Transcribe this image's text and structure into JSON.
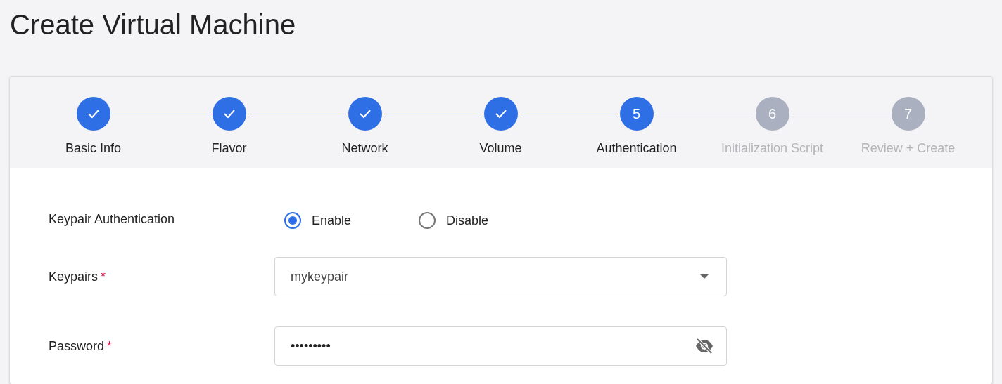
{
  "page_title": "Create Virtual Machine",
  "steps": [
    {
      "label": "Basic Info",
      "kind": "complete"
    },
    {
      "label": "Flavor",
      "kind": "complete"
    },
    {
      "label": "Network",
      "kind": "complete"
    },
    {
      "label": "Volume",
      "kind": "complete"
    },
    {
      "label": "Authentication",
      "kind": "active",
      "number": "5"
    },
    {
      "label": "Initialization Script",
      "kind": "pending",
      "number": "6"
    },
    {
      "label": "Review + Create",
      "kind": "pending",
      "number": "7"
    }
  ],
  "form": [
    {
      "kind": "radio",
      "label": "Keypair Authentication",
      "options": [
        {
          "label": "Enable",
          "selected": true
        },
        {
          "label": "Disable",
          "selected": false
        }
      ]
    },
    {
      "kind": "select",
      "label": "Keypairs",
      "required_mark": "*",
      "value": "mykeypair"
    },
    {
      "kind": "password",
      "label": "Password",
      "required_mark": "*",
      "value": "•••••••••"
    }
  ]
}
